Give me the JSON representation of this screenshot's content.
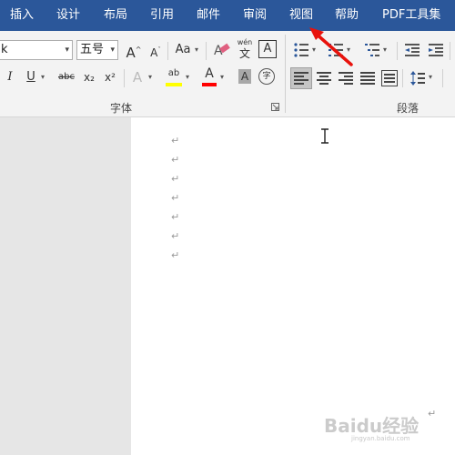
{
  "tabs": [
    "插入",
    "设计",
    "布局",
    "引用",
    "邮件",
    "审阅",
    "视图",
    "帮助",
    "PDF工具集"
  ],
  "font": {
    "name_partial": "k",
    "size": "五号",
    "grow_label": "A",
    "shrink_label": "A",
    "change_case_label": "Aa",
    "pinyin_top": "wén",
    "pinyin_bottom": "文",
    "char_border_label": "A",
    "italic_label": "I",
    "underline_label": "U",
    "strike_label": "abc",
    "subscript_label": "x₂",
    "superscript_label": "x²",
    "text_effect_label": "A",
    "highlight_label": "ab",
    "font_color_label": "A",
    "char_shading_label": "A",
    "enclose_label": "字",
    "group_label": "字体"
  },
  "paragraph": {
    "group_label": "段落"
  },
  "colors": {
    "ribbon_blue": "#2b579a",
    "highlight_yellow": "#ffff00",
    "font_red": "#ff0000",
    "annotation_arrow": "#e8120c"
  },
  "document": {
    "paragraph_mark": "↵",
    "paragraph_count": 7
  },
  "watermark": {
    "text": "Baidu经验",
    "sub": "jingyan.baidu.com"
  }
}
